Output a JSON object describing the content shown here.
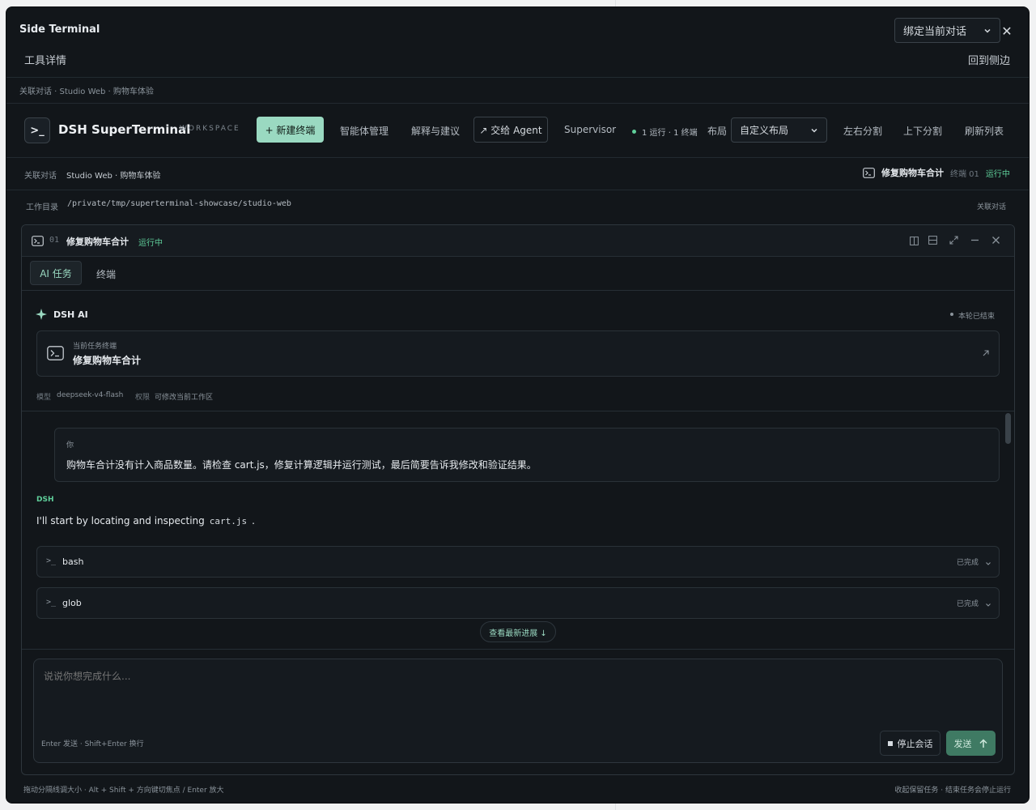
{
  "window": {
    "title": "Side Terminal",
    "subtitle": "工具详情",
    "bind_select": "绑定当前对话",
    "back_to_side": "回到侧边",
    "context_line": "关联对话 · Studio Web · 购物车体验"
  },
  "toolbar": {
    "logo": ">_",
    "brand": "DSH SuperTerminal",
    "workspace": "WORKSPACE",
    "new_terminal": "+ 新建终端",
    "agent_manage": "智能体管理",
    "explain": "解释与建议",
    "handoff": "↗ 交给 Agent",
    "supervisor": "Supervisor",
    "status": "1 运行 · 1 终端",
    "layout_label": "布局",
    "layout_value": "自定义布局",
    "split_lr": "左右分割",
    "split_tb": "上下分割",
    "refresh": "刷新列表"
  },
  "context": {
    "label": "关联对话",
    "value": "Studio Web · 购物车体验",
    "task_title": "修复购物车合计",
    "terminal_no": "终端 01",
    "running": "运行中",
    "workdir_label": "工作目录",
    "workdir_path": "/private/tmp/superterminal-showcase/studio-web",
    "link_conversation": "关联对话"
  },
  "panel": {
    "index": "01",
    "title": "修复购物车合计",
    "status": "运行中",
    "tabs": [
      "AI 任务",
      "终端"
    ],
    "ai": {
      "name": "DSH AI",
      "round_status": "本轮已结束",
      "task_card_label": "当前任务终端",
      "task_card_title": "修复购物车合计",
      "model_label": "模型",
      "model_value": "deepseek-v4-flash",
      "perm_label": "权限",
      "perm_value": "可修改当前工作区"
    },
    "chat": {
      "user_label": "你",
      "user_text": "购物车合计没有计入商品数量。请检查 cart.js，修复计算逻辑并运行测试，最后简要告诉我修改和验证结果。",
      "assistant_label": "DSH",
      "assistant_text_prefix": "I'll start by locating and inspecting",
      "assistant_code": "cart.js",
      "assistant_text_suffix": ".",
      "tools": [
        {
          "name": "bash",
          "status": "已完成"
        },
        {
          "name": "glob",
          "status": "已完成"
        }
      ],
      "latest_button": "查看最新进展 ↓"
    },
    "composer": {
      "placeholder": "说说你想完成什么...",
      "hint": "Enter 发送 · Shift+Enter 换行",
      "stop": "停止会话",
      "send": "发送"
    }
  },
  "footer": {
    "left": "拖动分隔线调大小 · Alt + Shift + 方向键切焦点 / Enter 放大",
    "right": "收起保留任务 · 结束任务会停止运行"
  },
  "colors": {
    "accent": "#9ad9c1",
    "running": "#5fcf9a",
    "send_button": "#3f7a63",
    "background": "#12161a"
  }
}
